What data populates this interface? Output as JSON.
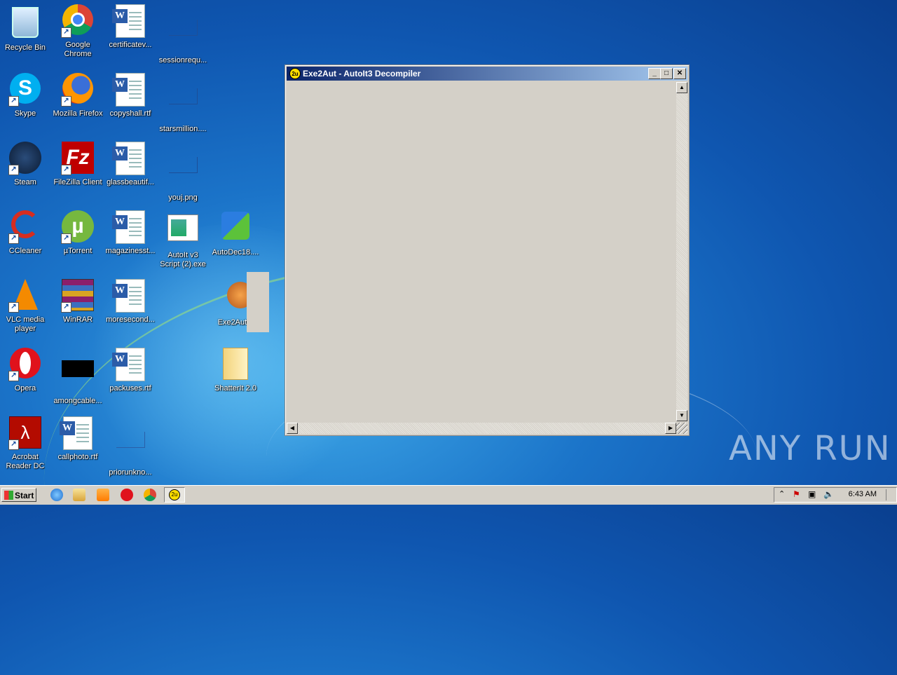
{
  "desktop_icons": {
    "recycle_bin": "Recycle Bin",
    "chrome": "Google Chrome",
    "cert": "certificatev...",
    "session": "sessionrequ...",
    "skype": "Skype",
    "firefox": "Mozilla Firefox",
    "copyshall": "copyshall.rtf",
    "stars": "starsmillion....",
    "steam": "Steam",
    "filezilla": "FileZilla Client",
    "glass": "glassbeautif...",
    "youj": "youj.png",
    "ccleaner": "CCleaner",
    "utorrent": "µTorrent",
    "magazines": "magazinesst...",
    "autoit": "AutoIt v3 Script (2).exe",
    "autodec": "AutoDec18....",
    "vlc": "VLC media player",
    "winrar": "WinRAR",
    "moresecond": "moresecond...",
    "exe2aut": "Exe2Aut.e",
    "opera": "Opera",
    "amongcable": "amongcable...",
    "packuses": "packuses.rtf",
    "shatterit": "ShatterIt 2.0",
    "acrobat": "Acrobat Reader DC",
    "callphoto": "callphoto.rtf",
    "priorunkno": "priorunkno..."
  },
  "window": {
    "title": "Exe2Aut - AutoIt3 Decompiler",
    "icon_label": "2u"
  },
  "taskbar": {
    "start_label": "Start",
    "active_app_label": "2u",
    "clock": "6:43 AM"
  },
  "watermark": "ANY RUN",
  "colors": {
    "title_active_start": "#0a246a",
    "title_active_end": "#a6caf0",
    "window_face": "#d4d0c8"
  }
}
